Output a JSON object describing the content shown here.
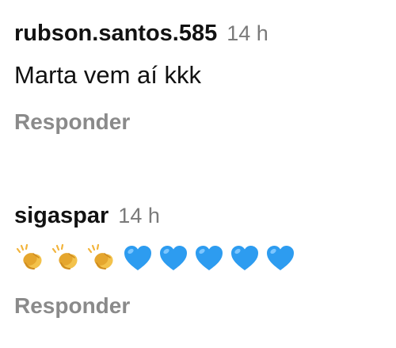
{
  "comments": [
    {
      "username": "rubson.santos.585",
      "time": "14 h",
      "text": "Marta vem aí kkk",
      "reply_label": "Responder"
    },
    {
      "username": "sigaspar",
      "time": "14 h",
      "emojis": [
        "clapping-hands-icon",
        "clapping-hands-icon",
        "clapping-hands-icon",
        "blue-heart-icon",
        "blue-heart-icon",
        "blue-heart-icon",
        "blue-heart-icon",
        "blue-heart-icon"
      ],
      "reply_label": "Responder"
    }
  ],
  "colors": {
    "username": "#121212",
    "timestamp": "#7a7a7a",
    "reply": "#8a8a8a",
    "blue_heart": "#2d9cf0",
    "clap": "#f0b43a"
  }
}
